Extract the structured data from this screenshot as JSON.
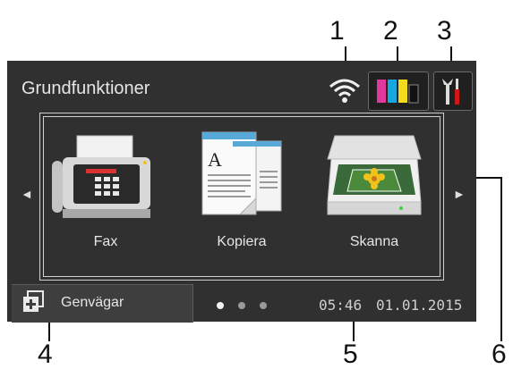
{
  "callouts": [
    "1",
    "2",
    "3",
    "4",
    "5",
    "6"
  ],
  "screen": {
    "title": "Grundfunktioner",
    "icons": {
      "wifi": "wifi-icon",
      "ink": "ink-cartridges-icon",
      "tools": "tools-icon"
    },
    "ink_colors": [
      "#e0389c",
      "#18a8e0",
      "#f2dc1c",
      "#111111"
    ],
    "functions": [
      {
        "label": "Fax",
        "icon": "fax-machine-icon"
      },
      {
        "label": "Kopiera",
        "icon": "copy-documents-icon"
      },
      {
        "label": "Skanna",
        "icon": "scanner-icon"
      }
    ],
    "nav": {
      "left": "◄",
      "right": "►"
    },
    "shortcut": {
      "label": "Genvägar",
      "icon": "shortcut-icon"
    },
    "page_indicator": {
      "total": 3,
      "active": 1
    },
    "time": "05:46",
    "date": "01.01.2015"
  }
}
